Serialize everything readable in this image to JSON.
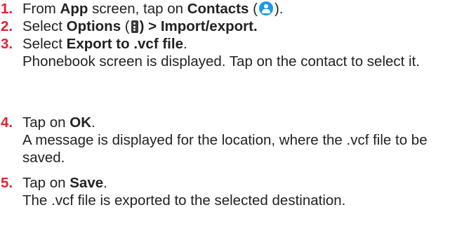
{
  "colors": {
    "step_number": "#e4202f",
    "text": "#222222",
    "contacts_icon_bg": "#1c98e6",
    "options_icon_bg": "#3a3a3a"
  },
  "steps": [
    {
      "number": "1.",
      "parts": [
        "From ",
        "App",
        " screen, tap on ",
        "Contacts",
        " (",
        ")."
      ],
      "icon": "contacts-icon"
    },
    {
      "number": "2.",
      "parts": [
        "Select ",
        "Options",
        " (",
        ") > Import/export."
      ],
      "icon": "options-menu-icon"
    },
    {
      "number": "3.",
      "parts": [
        "Select ",
        "Export to .vcf file",
        "."
      ],
      "detail": "Phonebook screen is displayed. Tap on the contact to select it."
    },
    {
      "number": "4.",
      "parts": [
        "Tap on ",
        "OK",
        "."
      ],
      "detail": "A message is displayed for the location, where the .vcf file to be saved."
    },
    {
      "number": "5.",
      "parts": [
        "Tap on ",
        "Save",
        "."
      ],
      "detail": "The .vcf file is exported to the selected destination."
    }
  ]
}
